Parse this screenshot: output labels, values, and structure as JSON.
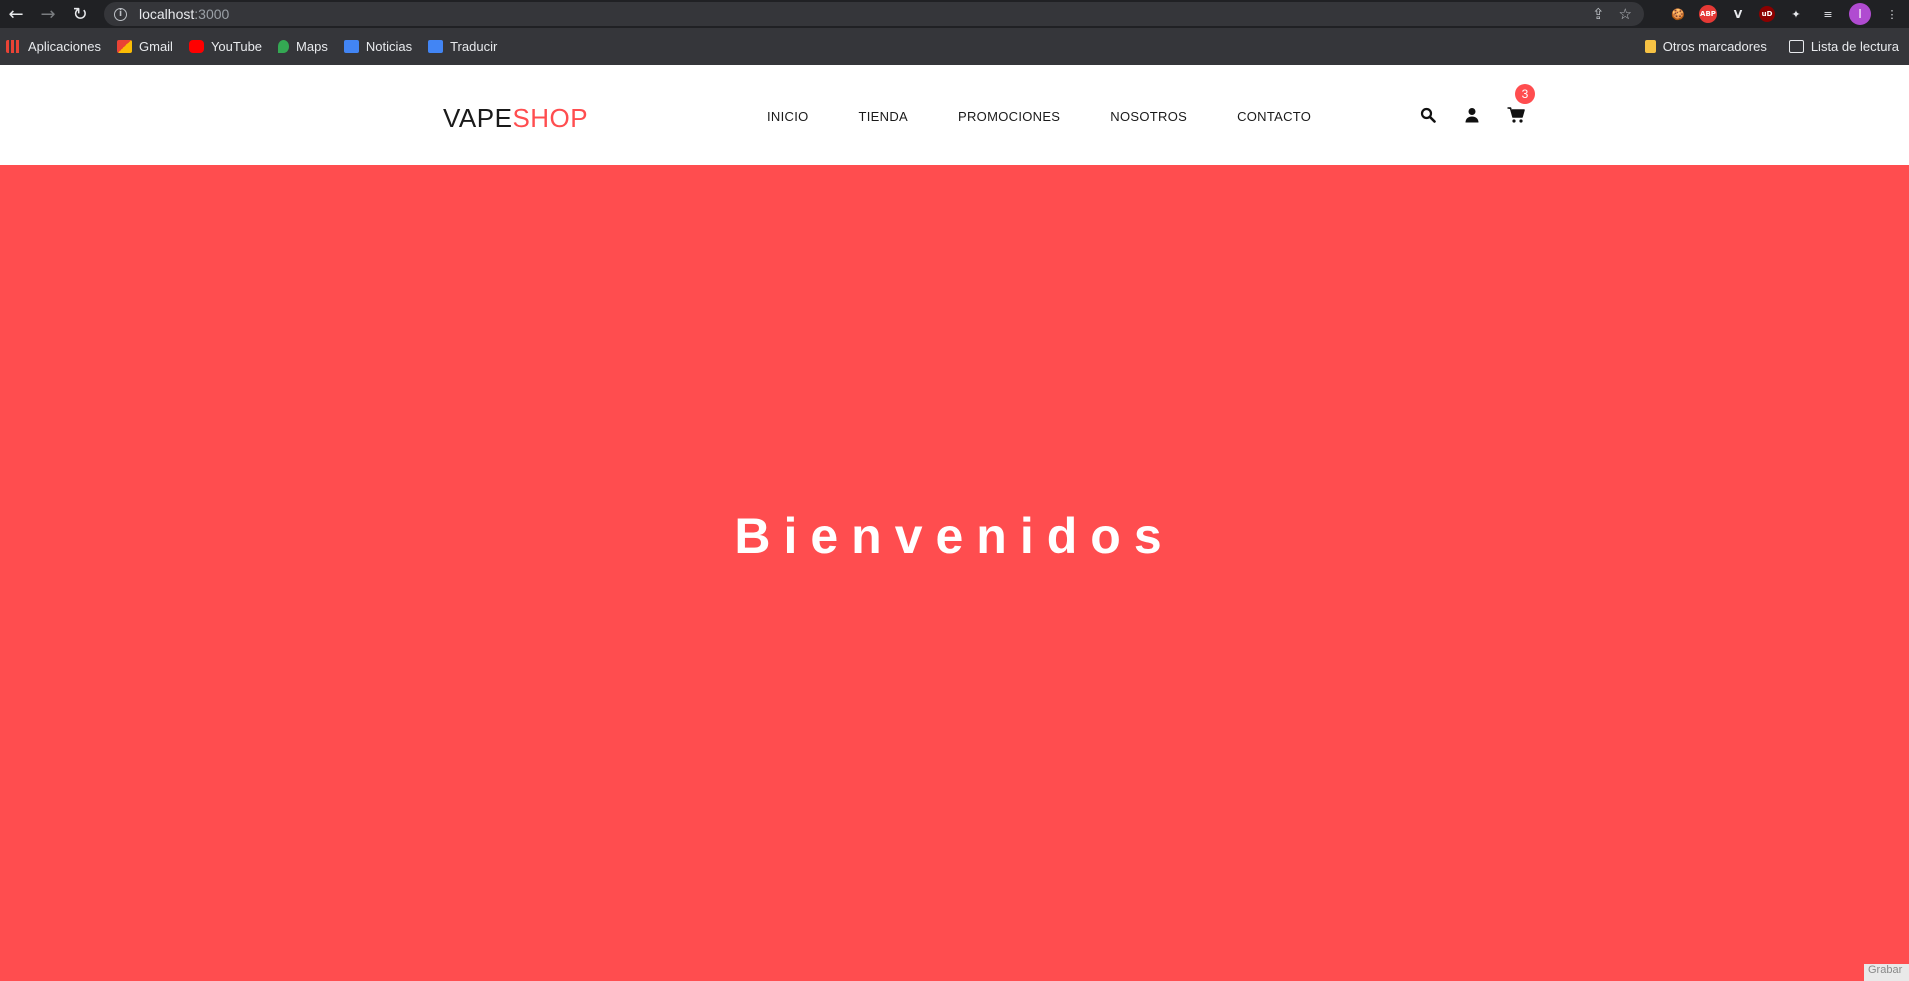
{
  "browser": {
    "url_host": "localhost",
    "url_port": ":3000",
    "bookmarks": [
      "Aplicaciones",
      "Gmail",
      "YouTube",
      "Maps",
      "Noticias",
      "Traducir"
    ],
    "bookmarks_right": [
      "Otros marcadores",
      "Lista de lectura"
    ],
    "extensions": {
      "abp": "ABP",
      "ud": "uD",
      "profile": "I"
    }
  },
  "header": {
    "logo_part1": "VAPE",
    "logo_part2": "SHOP",
    "menu": [
      "INICIO",
      "TIENDA",
      "PROMOCIONES",
      "NOSOTROS",
      "CONTACTO"
    ],
    "cart_count": "3"
  },
  "hero": {
    "title": "Bienvenidos"
  },
  "overlay": {
    "record_label": "Grabar"
  },
  "colors": {
    "accent": "#ff4d4f",
    "chrome_dark": "#202124",
    "chrome_bar": "#35363a"
  }
}
